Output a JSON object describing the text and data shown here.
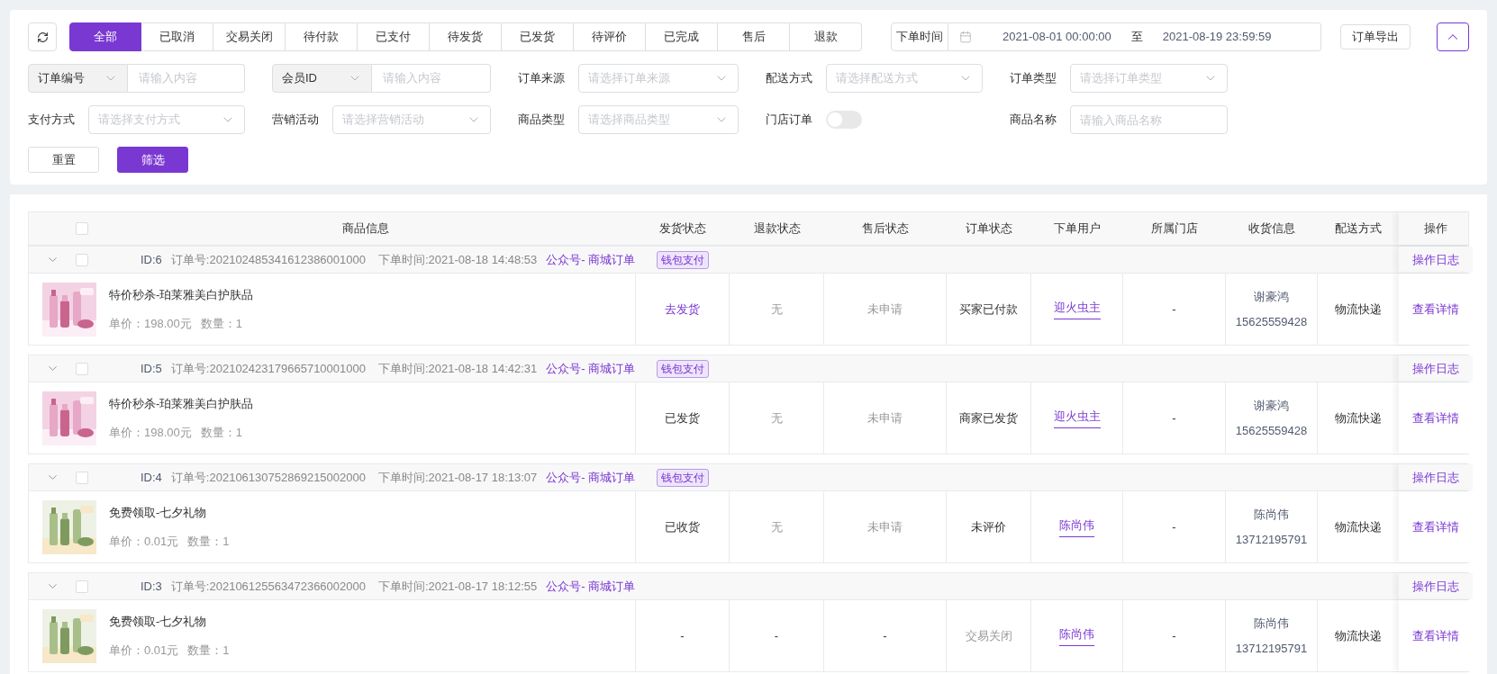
{
  "toolbar": {
    "status_tabs": [
      {
        "label": "全部",
        "selected": true
      },
      {
        "label": "已取消",
        "selected": false
      },
      {
        "label": "交易关闭",
        "selected": false
      },
      {
        "label": "待付款",
        "selected": false
      },
      {
        "label": "已支付",
        "selected": false
      },
      {
        "label": "待发货",
        "selected": false
      },
      {
        "label": "已发货",
        "selected": false
      },
      {
        "label": "待评价",
        "selected": false
      },
      {
        "label": "已完成",
        "selected": false
      },
      {
        "label": "售后",
        "selected": false
      },
      {
        "label": "退款",
        "selected": false
      }
    ],
    "date_filter": {
      "label": "下单时间",
      "start": "2021-08-01 00:00:00",
      "separator": "至",
      "end": "2021-08-19 23:59:59"
    },
    "export_button": "订单导出"
  },
  "filters": [
    {
      "kind": "select_input",
      "select": "订单编号",
      "placeholder": "请输入内容"
    },
    {
      "kind": "select_input",
      "select": "会员ID",
      "placeholder": "请输入内容"
    },
    {
      "kind": "select",
      "label": "订单来源",
      "placeholder": "请选择订单来源"
    },
    {
      "kind": "select",
      "label": "配送方式",
      "placeholder": "请选择配送方式"
    },
    {
      "kind": "select",
      "label": "订单类型",
      "placeholder": "请选择订单类型"
    },
    {
      "kind": "select",
      "label": "支付方式",
      "placeholder": "请选择支付方式"
    },
    {
      "kind": "select",
      "label": "营销活动",
      "placeholder": "请选择营销活动"
    },
    {
      "kind": "select",
      "label": "商品类型",
      "placeholder": "请选择商品类型"
    },
    {
      "kind": "toggle",
      "label": "门店订单",
      "on": false
    },
    {
      "kind": "input",
      "label": "商品名称",
      "placeholder": "请输入商品名称"
    }
  ],
  "buttons": [
    {
      "label": "重置",
      "kind": "default"
    },
    {
      "label": "筛选",
      "kind": "primary"
    }
  ],
  "table": {
    "select_all": {
      "checked": false
    },
    "columns": [
      "商品信息",
      "发货状态",
      "退款状态",
      "售后状态",
      "订单状态",
      "下单用户",
      "所属门店",
      "收货信息",
      "配送方式",
      "操作"
    ],
    "orders": [
      {
        "checked": false,
        "id": "ID:6",
        "order_no": "订单号:202102485341612386001000",
        "time": "下单时间:2021-08-18 14:48:53",
        "source": "公众号- 商城订单",
        "badge": "钱包支付",
        "log_link": "操作日志",
        "product": {
          "name": "特价秒杀-珀莱雅美白护肤品",
          "price": "单价：198.00元",
          "quantity": "数量：1"
        },
        "shipping": {
          "text": "去发货",
          "color": "#7a38d2"
        },
        "refund": {
          "text": "无",
          "color": "#999999"
        },
        "aftersale": {
          "text": "未申请",
          "color": "#999999"
        },
        "status": {
          "text": "买家已付款"
        },
        "user": "迎火虫主",
        "store": "-",
        "receiver": "谢豪鸿",
        "phone": "15625559428",
        "delivery": "物流快递",
        "detail_link": "查看详情"
      },
      {
        "checked": false,
        "id": "ID:5",
        "order_no": "订单号:202102423179665710001000",
        "time": "下单时间:2021-08-18 14:42:31",
        "source": "公众号- 商城订单",
        "badge": "钱包支付",
        "log_link": "操作日志",
        "product": {
          "name": "特价秒杀-珀莱雅美白护肤品",
          "price": "单价：198.00元",
          "quantity": "数量：1"
        },
        "shipping": {
          "text": "已发货"
        },
        "refund": {
          "text": "无",
          "color": "#999999"
        },
        "aftersale": {
          "text": "未申请",
          "color": "#999999"
        },
        "status": {
          "text": "商家已发货"
        },
        "user": "迎火虫主",
        "store": "-",
        "receiver": "谢豪鸿",
        "phone": "15625559428",
        "delivery": "物流快递",
        "detail_link": "查看详情"
      },
      {
        "checked": false,
        "id": "ID:4",
        "order_no": "订单号:202106130752869215002000",
        "time": "下单时间:2021-08-17 18:13:07",
        "source": "公众号- 商城订单",
        "badge": "钱包支付",
        "log_link": "操作日志",
        "product": {
          "name": "免费领取-七夕礼物",
          "price": "单价：0.01元",
          "quantity": "数量：1"
        },
        "shipping": {
          "text": "已收货"
        },
        "refund": {
          "text": "无",
          "color": "#999999"
        },
        "aftersale": {
          "text": "未申请",
          "color": "#999999"
        },
        "status": {
          "text": "未评价"
        },
        "user": "陈尚伟",
        "store": "-",
        "receiver": "陈尚伟",
        "phone": "13712195791",
        "delivery": "物流快递",
        "detail_link": "查看详情"
      },
      {
        "checked": false,
        "id": "ID:3",
        "order_no": "订单号:202106125563472366002000",
        "time": "下单时间:2021-08-17 18:12:55",
        "source": "公众号- 商城订单",
        "log_link": "操作日志",
        "product": {
          "name": "免费领取-七夕礼物",
          "price": "单价：0.01元",
          "quantity": "数量：1"
        },
        "shipping": {
          "text": "-"
        },
        "refund": {
          "text": "-"
        },
        "aftersale": {
          "text": "-"
        },
        "status": {
          "text": "交易关闭",
          "color": "#999999"
        },
        "user": "陈尚伟",
        "store": "-",
        "receiver": "陈尚伟",
        "phone": "13712195791",
        "delivery": "物流快递",
        "detail_link": "查看详情"
      }
    ]
  }
}
